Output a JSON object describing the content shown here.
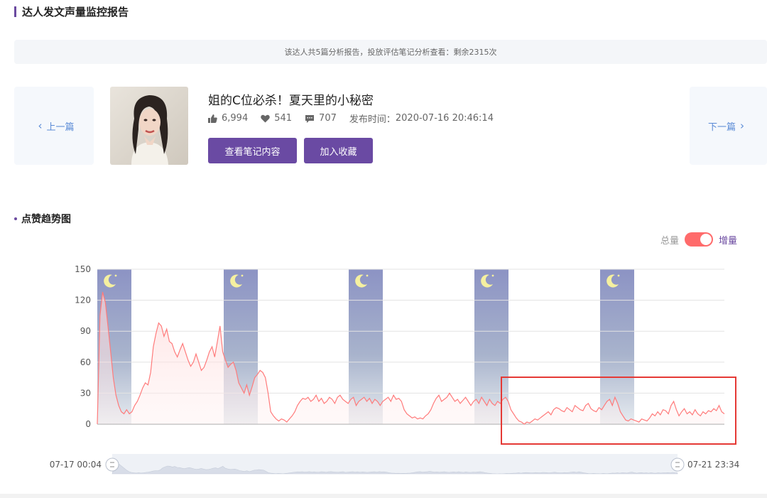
{
  "header": {
    "title": "达人发文声量监控报告"
  },
  "notice": {
    "text": "该达人共5篇分析报告，投放评估笔记分析查看：剩余2315次"
  },
  "nav": {
    "prev_label": "上一篇",
    "next_label": "下一篇"
  },
  "note": {
    "title": "姐的C位必杀！夏天里的小秘密",
    "likes": "6,994",
    "favorites": "541",
    "comments": "707",
    "publish_label": "发布时间：",
    "publish_time": "2020-07-16 20:46:14"
  },
  "actions": {
    "view_label": "查看笔记内容",
    "favorite_label": "加入收藏"
  },
  "chart_section": {
    "title": "点赞趋势图"
  },
  "toggle": {
    "left_label": "总量",
    "right_label": "增量",
    "active": "增量"
  },
  "slider": {
    "start_label": "07-17 00:04",
    "end_label": "07-21 23:34"
  },
  "colors": {
    "accent": "#6a4aa3",
    "line": "#ff7b7b",
    "toggle_on": "#ff6b6b",
    "highlight_box": "#e53935",
    "night": "#8c93c4"
  },
  "chart_data": {
    "type": "area",
    "ylim": [
      0,
      150
    ],
    "yticks": [
      0,
      30,
      60,
      90,
      120,
      150
    ],
    "x_range": [
      "07-17 00:04",
      "07-21 23:34"
    ],
    "night_band_icon": "moon-icon",
    "series": [
      {
        "values": [
          0,
          105,
          128,
          118,
          95,
          70,
          45,
          28,
          18,
          12,
          10,
          14,
          10,
          12,
          18,
          22,
          28,
          35,
          40,
          38,
          50,
          75,
          88,
          98,
          95,
          85,
          92,
          80,
          78,
          70,
          65,
          72,
          78,
          70,
          62,
          56,
          60,
          68,
          60,
          52,
          55,
          62,
          70,
          75,
          65,
          80,
          95,
          70,
          62,
          55,
          58,
          60,
          52,
          40,
          35,
          30,
          38,
          28,
          36,
          45,
          48,
          52,
          50,
          45,
          30,
          12,
          8,
          5,
          3,
          5,
          4,
          2,
          5,
          8,
          12,
          18,
          22,
          25,
          24,
          26,
          22,
          24,
          28,
          22,
          25,
          20,
          22,
          26,
          24,
          20,
          26,
          28,
          24,
          22,
          20,
          24,
          26,
          18,
          22,
          24,
          26,
          22,
          25,
          20,
          24,
          22,
          18,
          22,
          24,
          26,
          22,
          28,
          24,
          25,
          22,
          14,
          10,
          8,
          6,
          7,
          5,
          6,
          5,
          8,
          10,
          14,
          20,
          25,
          28,
          22,
          24,
          26,
          30,
          26,
          22,
          24,
          20,
          23,
          26,
          22,
          18,
          22,
          24,
          20,
          26,
          22,
          18,
          24,
          20,
          18,
          22,
          20,
          24,
          26,
          22,
          14,
          10,
          6,
          3,
          2,
          0,
          2,
          1,
          3,
          5,
          4,
          6,
          8,
          10,
          12,
          9,
          14,
          16,
          15,
          13,
          12,
          16,
          14,
          12,
          18,
          16,
          14,
          13,
          18,
          20,
          15,
          13,
          12,
          16,
          14,
          18,
          22,
          24,
          18,
          26,
          20,
          12,
          8,
          4,
          3,
          5,
          4,
          3,
          2,
          5,
          4,
          3,
          6,
          10,
          8,
          12,
          9,
          14,
          13,
          10,
          18,
          22,
          14,
          8,
          12,
          15,
          10,
          12,
          9,
          14,
          10,
          8,
          12,
          10,
          13,
          12,
          15,
          13,
          18,
          12,
          10
        ]
      }
    ],
    "annotation": "highlight-box"
  }
}
